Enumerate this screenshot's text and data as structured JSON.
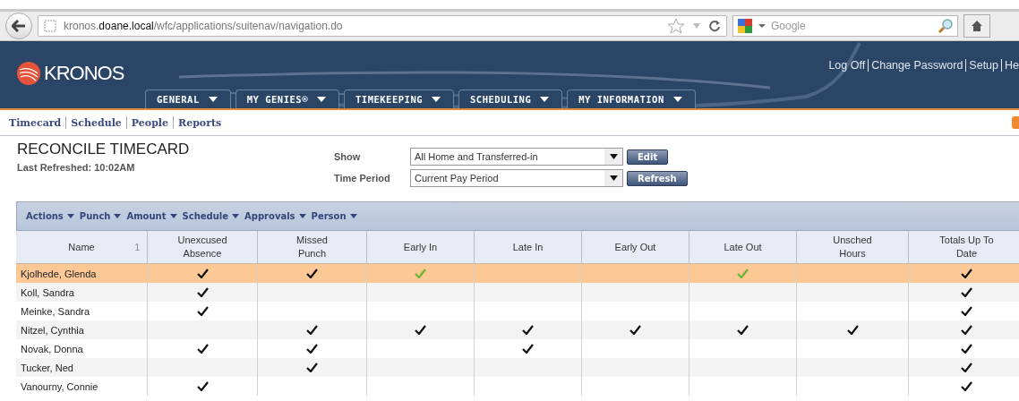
{
  "browser": {
    "url_host_prefix": "kronos.",
    "url_host": "doane.local",
    "url_path": "/wfc/applications/suitenav/navigation.do",
    "search_placeholder": "Google"
  },
  "header": {
    "logo": "KRONOS",
    "links": [
      "Log Off",
      "Change Password",
      "Setup",
      "He"
    ],
    "menus": [
      {
        "label": "GENERAL"
      },
      {
        "label": "MY GENIES®"
      },
      {
        "label": "TIMEKEEPING"
      },
      {
        "label": "SCHEDULING"
      },
      {
        "label": "MY INFORMATION"
      }
    ]
  },
  "subnav": [
    "Timecard",
    "Schedule",
    "People",
    "Reports"
  ],
  "page": {
    "title": "RECONCILE TIMECARD",
    "refreshed": "Last Refreshed: 10:02AM",
    "show": {
      "label": "Show",
      "value": "All Home and Transferred-in",
      "button": "Edit"
    },
    "period": {
      "label": "Time Period",
      "value": "Current Pay Period",
      "button": "Refresh"
    }
  },
  "toolbar": [
    "Actions",
    "Punch",
    "Amount",
    "Schedule",
    "Approvals",
    "Person"
  ],
  "table": {
    "columns": [
      {
        "label": "Name",
        "sort": "1"
      },
      {
        "label": "Unexcused Absence"
      },
      {
        "label": "Missed Punch"
      },
      {
        "label": "Early In"
      },
      {
        "label": "Late In"
      },
      {
        "label": "Early Out"
      },
      {
        "label": "Late Out"
      },
      {
        "label": "Unsched Hours"
      },
      {
        "label": "Totals Up To Date"
      }
    ],
    "rows": [
      {
        "name": "Kjolhede, Glenda",
        "selected": true,
        "cells": [
          {
            "checked": true,
            "color": "#111111"
          },
          {
            "checked": true,
            "color": "#111111"
          },
          {
            "checked": true,
            "color": "#66b832"
          },
          {
            "checked": false
          },
          {
            "checked": false
          },
          {
            "checked": true,
            "color": "#66b832"
          },
          {
            "checked": false
          },
          {
            "checked": true,
            "color": "#111111"
          }
        ]
      },
      {
        "name": "Koll, Sandra",
        "selected": false,
        "cells": [
          {
            "checked": true,
            "color": "#111111"
          },
          {
            "checked": false
          },
          {
            "checked": false
          },
          {
            "checked": false
          },
          {
            "checked": false
          },
          {
            "checked": false
          },
          {
            "checked": false
          },
          {
            "checked": true,
            "color": "#111111"
          }
        ]
      },
      {
        "name": "Meinke, Sandra",
        "selected": false,
        "cells": [
          {
            "checked": true,
            "color": "#111111"
          },
          {
            "checked": false
          },
          {
            "checked": false
          },
          {
            "checked": false
          },
          {
            "checked": false
          },
          {
            "checked": false
          },
          {
            "checked": false
          },
          {
            "checked": true,
            "color": "#111111"
          }
        ]
      },
      {
        "name": "Nitzel, Cynthia",
        "selected": false,
        "cells": [
          {
            "checked": false
          },
          {
            "checked": true,
            "color": "#111111"
          },
          {
            "checked": true,
            "color": "#111111"
          },
          {
            "checked": true,
            "color": "#111111"
          },
          {
            "checked": true,
            "color": "#111111"
          },
          {
            "checked": true,
            "color": "#111111"
          },
          {
            "checked": true,
            "color": "#111111"
          },
          {
            "checked": true,
            "color": "#111111"
          }
        ]
      },
      {
        "name": "Novak, Donna",
        "selected": false,
        "cells": [
          {
            "checked": true,
            "color": "#111111"
          },
          {
            "checked": true,
            "color": "#111111"
          },
          {
            "checked": false
          },
          {
            "checked": true,
            "color": "#111111"
          },
          {
            "checked": false
          },
          {
            "checked": false
          },
          {
            "checked": false
          },
          {
            "checked": true,
            "color": "#111111"
          }
        ]
      },
      {
        "name": "Tucker, Ned",
        "selected": false,
        "cells": [
          {
            "checked": false
          },
          {
            "checked": true,
            "color": "#111111"
          },
          {
            "checked": false
          },
          {
            "checked": false
          },
          {
            "checked": false
          },
          {
            "checked": false
          },
          {
            "checked": false
          },
          {
            "checked": true,
            "color": "#111111"
          }
        ]
      },
      {
        "name": "Vanourny, Connie",
        "selected": false,
        "cells": [
          {
            "checked": true,
            "color": "#111111"
          },
          {
            "checked": false
          },
          {
            "checked": false
          },
          {
            "checked": false
          },
          {
            "checked": false
          },
          {
            "checked": false
          },
          {
            "checked": false
          },
          {
            "checked": true,
            "color": "#111111"
          }
        ]
      }
    ]
  }
}
